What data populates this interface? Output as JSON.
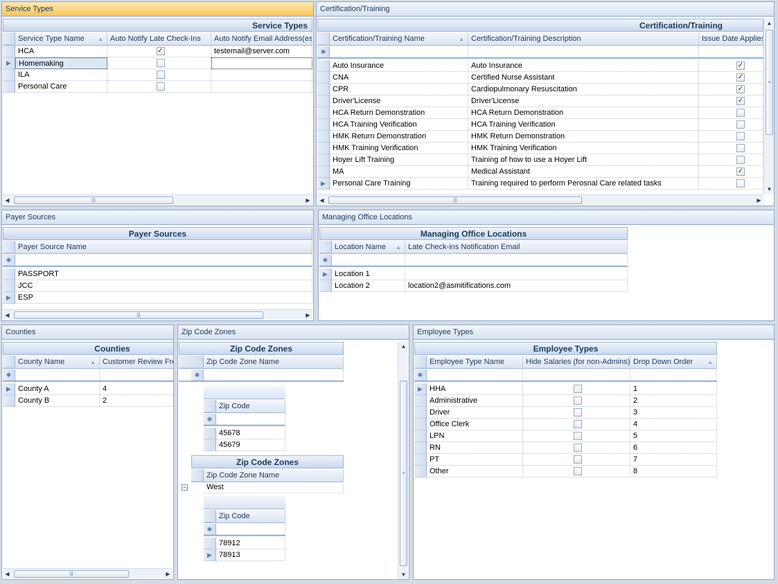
{
  "service_types": {
    "panel_title": "Service Types",
    "grid_title": "Service Types",
    "columns": [
      "Service Type Name",
      "Auto Notify Late Check-Ins",
      "Auto Notify Email Address(es)"
    ],
    "rows": [
      {
        "name": "HCA",
        "notify": true,
        "email": "testemail@server.com"
      },
      {
        "name": "Homemaking",
        "notify": false,
        "email": ""
      },
      {
        "name": "ILA",
        "notify": false,
        "email": ""
      },
      {
        "name": "Personal Care",
        "notify": false,
        "email": ""
      }
    ]
  },
  "certification": {
    "panel_title": "Certification/Training",
    "grid_title": "Certification/Training",
    "columns": [
      "Certification/Training Name",
      "Certification/Training Description",
      "Issue Date Applies"
    ],
    "rows": [
      {
        "name": "Auto Insurance",
        "desc": "Auto Insurance",
        "issue": true
      },
      {
        "name": "CNA",
        "desc": "Certified Nurse Assistant",
        "issue": true
      },
      {
        "name": "CPR",
        "desc": "Cardiopulmonary Resuscitation",
        "issue": true
      },
      {
        "name": "Driver'License",
        "desc": "Driver'License",
        "issue": true
      },
      {
        "name": "HCA Return Demonstration",
        "desc": "HCA Return Demonstration",
        "issue": false
      },
      {
        "name": "HCA Training Verification",
        "desc": "HCA Training Verification",
        "issue": false
      },
      {
        "name": "HMK Return Demonstration",
        "desc": "HMK Return Demonstration",
        "issue": false
      },
      {
        "name": "HMK Training Verification",
        "desc": "HMK Training Verification",
        "issue": false
      },
      {
        "name": "Hoyer Lift Training",
        "desc": "Training of how to use a Hoyer Lift",
        "issue": false
      },
      {
        "name": "MA",
        "desc": "Medical Assistant",
        "issue": true
      },
      {
        "name": "Personal Care Training",
        "desc": "Training required to perform Perosnal Care related tasks",
        "issue": false
      }
    ]
  },
  "payer_sources": {
    "panel_title": "Payer Sources",
    "grid_title": "Payer Sources",
    "columns": [
      "Payer Source Name"
    ],
    "rows": [
      "PASSPORT",
      "JCC",
      "ESP"
    ]
  },
  "managing_office": {
    "panel_title": "Managing Office Locations",
    "grid_title": "Managing Office Locations",
    "columns": [
      "Location Name",
      "Late Check-ins Notification Email"
    ],
    "rows": [
      {
        "name": "Location 1",
        "email": ""
      },
      {
        "name": "Location 2",
        "email": "location2@asmitifications.com"
      }
    ]
  },
  "counties": {
    "panel_title": "Counties",
    "grid_title": "Counties",
    "columns": [
      "County Name",
      "Customer Review Fre"
    ],
    "rows": [
      {
        "name": "County A",
        "freq": "4"
      },
      {
        "name": "County B",
        "freq": "2"
      }
    ]
  },
  "zip_zones": {
    "panel_title": "Zip Code Zones",
    "grid_title": "Zip Code Zones",
    "column": "Zip Code Zone Name",
    "zip_column": "Zip Code",
    "group1_zips": [
      "45678",
      "45679"
    ],
    "nested_title": "Zip Code Zones",
    "nested_column": "Zip Code Zone Name",
    "nested_row": "West",
    "group2_zips": [
      "78912",
      "78913"
    ]
  },
  "employee_types": {
    "panel_title": "Employee Types",
    "grid_title": "Employee Types",
    "columns": [
      "Employee Type Name",
      "Hide Salaries (for non-Admins)",
      "Drop Down Order"
    ],
    "rows": [
      {
        "name": "HHA",
        "order": "1"
      },
      {
        "name": "Administrative",
        "order": "2"
      },
      {
        "name": "Driver",
        "order": "3"
      },
      {
        "name": "Office Clerk",
        "order": "4"
      },
      {
        "name": "LPN",
        "order": "5"
      },
      {
        "name": "RN",
        "order": "6"
      },
      {
        "name": "PT",
        "order": "7"
      },
      {
        "name": "Other",
        "order": "8"
      }
    ]
  },
  "glyphs": {
    "row_indicator": "▶",
    "new_row": "✱",
    "check": "✓",
    "sort": "▲",
    "collapse": "−"
  }
}
